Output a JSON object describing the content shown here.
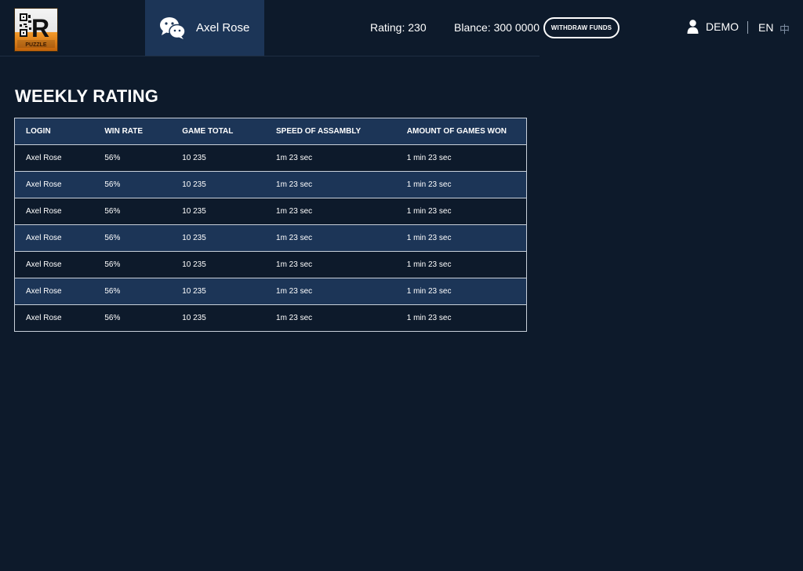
{
  "header": {
    "logo_icon": "qr-puzzle-logo-icon",
    "user_name": "Axel Rose",
    "user_icon": "wechat-icon",
    "rating_text": "Rating: 230",
    "balance_text": "Blance: 300 0000",
    "withdraw_label": "WITHDRAW FUNDS",
    "account_icon": "person-icon",
    "account_label": "DEMO",
    "lang_en": "EN",
    "lang_zh": "中"
  },
  "main": {
    "title": "WEEKLY RATING",
    "table": {
      "columns": [
        "LOGIN",
        "WIN RATE",
        "GAME TOTAL",
        "SPEED OF ASSAMBLY",
        "AMOUNT OF GAMES WON"
      ],
      "rows": [
        [
          "Axel Rose",
          "56%",
          "10 235",
          "1m 23 sec",
          "1 min 23 sec"
        ],
        [
          "Axel Rose",
          "56%",
          "10 235",
          "1m 23 sec",
          "1 min 23 sec"
        ],
        [
          "Axel Rose",
          "56%",
          "10 235",
          "1m 23 sec",
          "1 min 23 sec"
        ],
        [
          "Axel Rose",
          "56%",
          "10 235",
          "1m 23 sec",
          "1 min 23 sec"
        ],
        [
          "Axel Rose",
          "56%",
          "10 235",
          "1m 23 sec",
          "1 min 23 sec"
        ],
        [
          "Axel Rose",
          "56%",
          "10 235",
          "1m 23 sec",
          "1 min 23 sec"
        ],
        [
          "Axel Rose",
          "56%",
          "10 235",
          "1m 23 sec",
          "1 min 23 sec"
        ]
      ]
    }
  },
  "colors": {
    "background": "#0d1a2b",
    "accent_row": "#1c3557",
    "border": "#c8d0da",
    "text": "#ffffff",
    "muted": "#7f8ea3"
  }
}
